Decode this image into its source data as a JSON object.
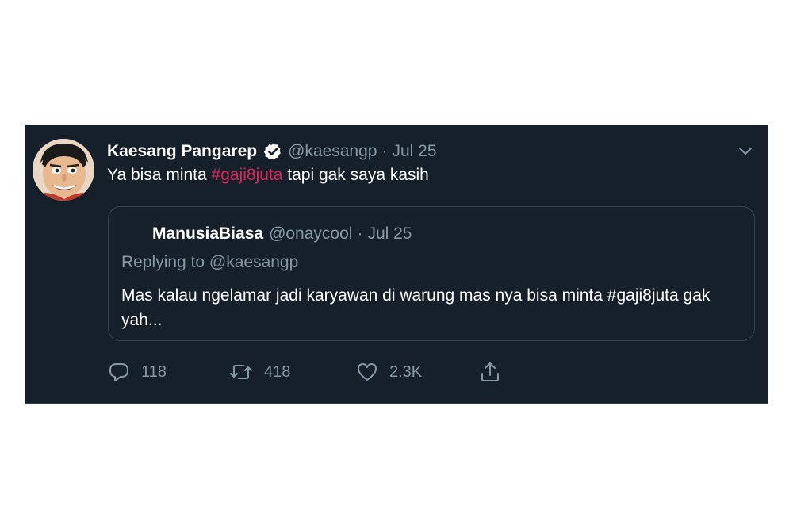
{
  "tweet": {
    "author": {
      "name": "Kaesang Pangarep",
      "handle": "@kaesangp",
      "verified": true,
      "avatar_icon": "avatar-caricature"
    },
    "separator": "·",
    "date": "Jul 25",
    "text_before": "Ya bisa minta ",
    "hashtag": "#gaji8juta",
    "text_after": " tapi gak saya kasih",
    "quote": {
      "author_name": "ManusiaBiasa",
      "handle": "@onaycool",
      "separator": "·",
      "date": "Jul 25",
      "reply_line": "Replying to @kaesangp",
      "text": "Mas kalau ngelamar jadi karyawan di warung mas nya bisa minta #gaji8juta gak yah..."
    },
    "actions": {
      "replies": "118",
      "retweets": "418",
      "likes": "2.3K"
    }
  },
  "colors": {
    "background": "#15202b",
    "text": "#ffffff",
    "secondary": "#8899a6",
    "hashtag": "#e0245e",
    "border": "#38444d"
  }
}
